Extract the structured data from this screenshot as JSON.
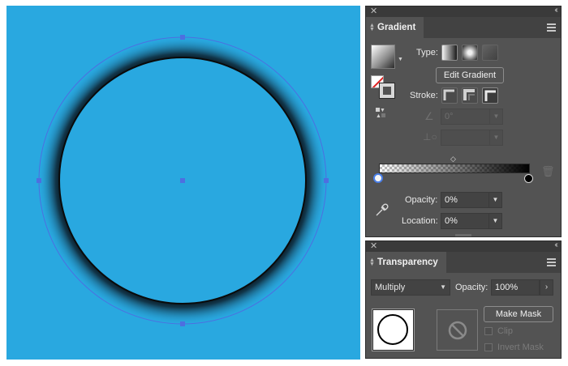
{
  "canvas": {
    "background": "#29a8e0"
  },
  "gradient_panel": {
    "close": "✕",
    "collapse": "‹‹",
    "tab": "Gradient",
    "type_label": "Type:",
    "edit_gradient": "Edit Gradient",
    "stroke_label": "Stroke:",
    "angle_value": "0°",
    "aspect_value": "",
    "opacity_label": "Opacity:",
    "opacity_value": "0%",
    "location_label": "Location:",
    "location_value": "0%"
  },
  "transparency_panel": {
    "close": "✕",
    "collapse": "‹‹",
    "tab": "Transparency",
    "blend_mode": "Multiply",
    "opacity_label": "Opacity:",
    "opacity_value": "100%",
    "make_mask": "Make Mask",
    "clip_label": "Clip",
    "invert_mask_label": "Invert Mask"
  }
}
